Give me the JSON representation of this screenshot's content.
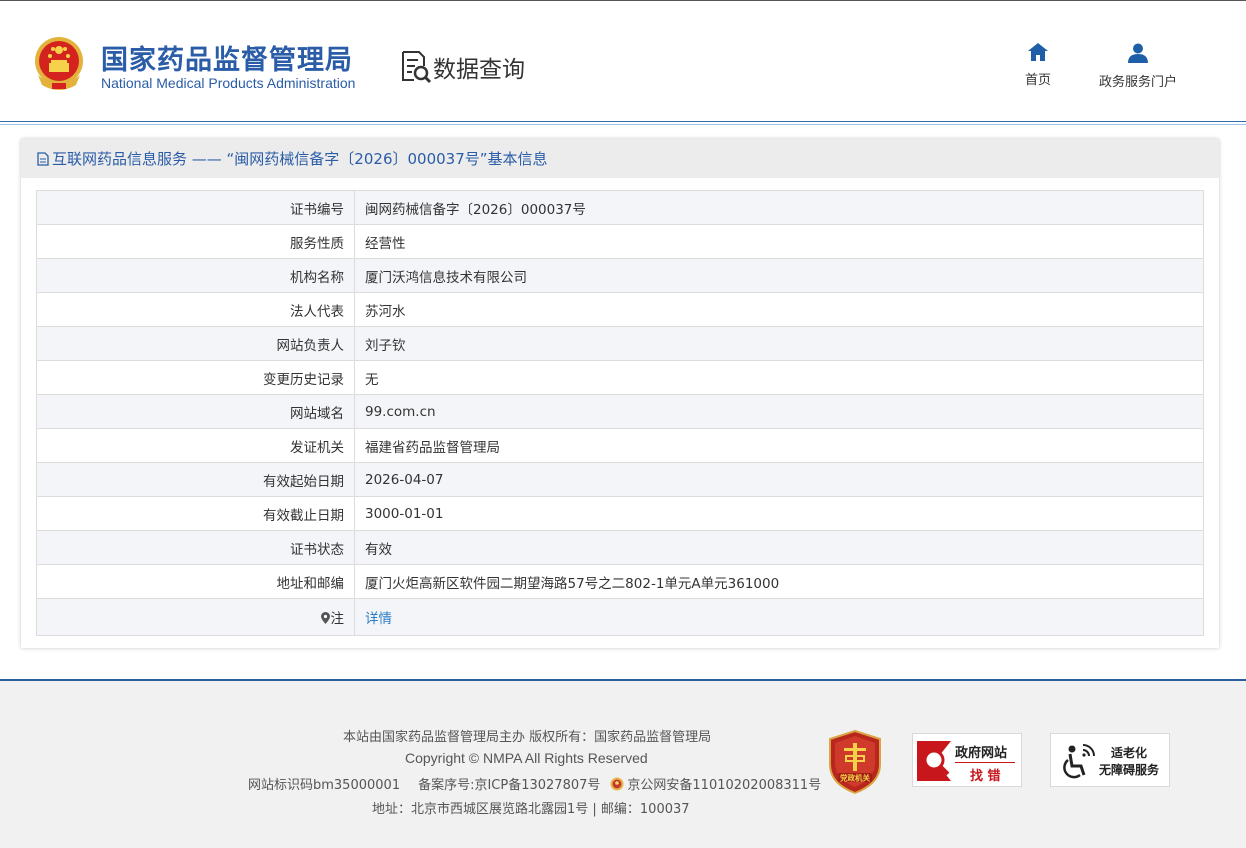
{
  "header": {
    "brand_cn": "国家药品监督管理局",
    "brand_en": "National Medical Products Administration",
    "section_title": "数据查询",
    "nav": [
      {
        "label": "首页",
        "icon": "home-icon"
      },
      {
        "label": "政务服务门户",
        "icon": "user-icon"
      }
    ]
  },
  "card": {
    "title": "互联网药品信息服务 —— “闽网药械信备字〔2026〕000037号”基本信息",
    "rows": [
      {
        "key": "证书编号",
        "value": "闽网药械信备字〔2026〕000037号"
      },
      {
        "key": "服务性质",
        "value": "经营性"
      },
      {
        "key": "机构名称",
        "value": "厦门沃鸿信息技术有限公司"
      },
      {
        "key": "法人代表",
        "value": "苏河水"
      },
      {
        "key": "网站负责人",
        "value": "刘子钦"
      },
      {
        "key": "变更历史记录",
        "value": "无"
      },
      {
        "key": "网站域名",
        "value": "99.com.cn"
      },
      {
        "key": "发证机关",
        "value": "福建省药品监督管理局"
      },
      {
        "key": "有效起始日期",
        "value": "2026-04-07"
      },
      {
        "key": "有效截止日期",
        "value": "3000-01-01"
      },
      {
        "key": "证书状态",
        "value": "有效"
      },
      {
        "key": "地址和邮编",
        "value": "厦门火炬高新区软件园二期望海路57号之二802-1单元A单元361000"
      }
    ],
    "note_key": "注",
    "note_link": "详情"
  },
  "footer": {
    "line1": "本站由国家药品监督管理局主办 版权所有：国家药品监督管理局",
    "line2": "Copyright © NMPA All Rights Reserved",
    "site_id": "网站标识码bm35000001",
    "icp": "备案序号:京ICP备13027807号",
    "police": "京公网安备11010202008311号",
    "address": "地址：北京市西城区展览路北露园1号 | 邮编：100037",
    "badge_party": "党政机关",
    "badge_jc_1": "政府网站",
    "badge_jc_2": "找 错",
    "badge_acc_1": "适老化",
    "badge_acc_2": "无障碍服务"
  },
  "colors": {
    "brand_blue": "#2a5ca8",
    "link_blue": "#2a7cc7",
    "header_border": "#2f6fb0",
    "footer_bg": "#f1f1f1",
    "row_alt": "#f4f5f9",
    "badge_red": "#c8161d"
  }
}
